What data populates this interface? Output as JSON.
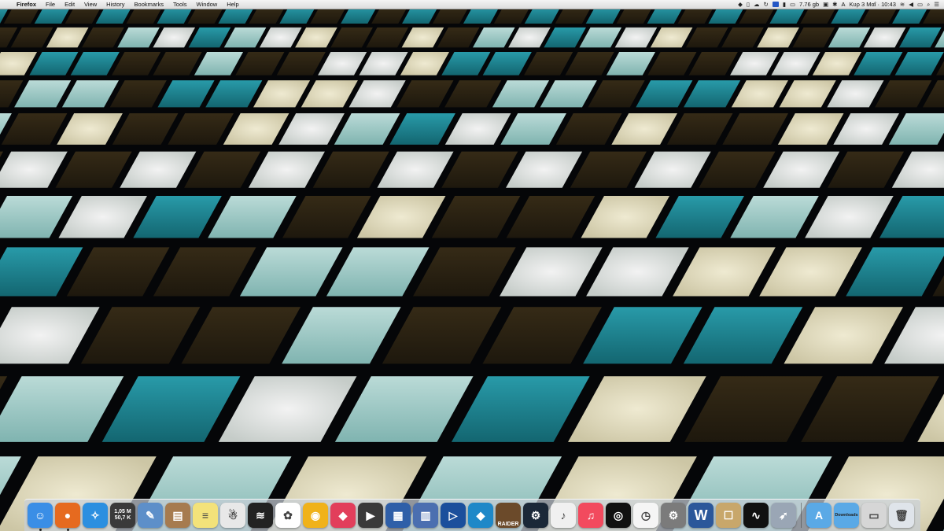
{
  "menubar": {
    "apple_glyph": "",
    "app_name": "Firefox",
    "menus": [
      "File",
      "Edit",
      "View",
      "History",
      "Bookmarks",
      "Tools",
      "Window",
      "Help"
    ],
    "status": {
      "disk_free": "7.76 gb",
      "keyboard": "A",
      "datetime": "Κυρ 3 Μαΐ · 10:43",
      "search_glyph": "⌕",
      "list_glyph": "☰"
    }
  },
  "dock": {
    "network_meter": {
      "upload": "1,05 M",
      "download": "50,7 K"
    },
    "tomb_raider_label": "RAIDER",
    "word_label": "W",
    "downloads_label": "Downloads",
    "apps": [
      {
        "name": "finder-icon",
        "color": "#3a8ee6",
        "glyph": "☺"
      },
      {
        "name": "firefox-icon",
        "color": "#e66a1f",
        "glyph": "●"
      },
      {
        "name": "safari-icon",
        "color": "#2b8fe0",
        "glyph": "✧"
      },
      {
        "name": "network-meter-icon",
        "color": "#3a3a3a",
        "glyph": ""
      },
      {
        "name": "preview-icon",
        "color": "#5d8fc9",
        "glyph": "✎"
      },
      {
        "name": "contacts-icon",
        "color": "#a67b4f",
        "glyph": "▤"
      },
      {
        "name": "notes-icon",
        "color": "#f3e27a",
        "glyph": "≡"
      },
      {
        "name": "ghost-app-icon",
        "color": "#e8e8e8",
        "glyph": "☃"
      },
      {
        "name": "wifi-scanner-icon",
        "color": "#222",
        "glyph": "≋"
      },
      {
        "name": "photos-icon",
        "color": "#ffffff",
        "glyph": "✿"
      },
      {
        "name": "color-picker-icon",
        "color": "#f0b21a",
        "glyph": "◉"
      },
      {
        "name": "color-wheel-icon",
        "color": "#e23e5b",
        "glyph": "◆"
      },
      {
        "name": "final-cut-icon",
        "color": "#3a3a3a",
        "glyph": "▶"
      },
      {
        "name": "screen-share-icon",
        "color": "#2f5fa8",
        "glyph": "▦"
      },
      {
        "name": "archive-utility-icon",
        "color": "#4b6fb0",
        "glyph": "▥"
      },
      {
        "name": "video-player-icon",
        "color": "#1b4f9c",
        "glyph": "▷"
      },
      {
        "name": "kodi-icon",
        "color": "#1e88c8",
        "glyph": "◆"
      },
      {
        "name": "tomb-raider-icon",
        "color": "#6b4a2a",
        "glyph": ""
      },
      {
        "name": "steam-icon",
        "color": "#1b2838",
        "glyph": "⚙"
      },
      {
        "name": "sheet-music-icon",
        "color": "#f0f0f0",
        "glyph": "♪"
      },
      {
        "name": "itunes-icon",
        "color": "#f24a5e",
        "glyph": "♫"
      },
      {
        "name": "vinyl-player-icon",
        "color": "#111",
        "glyph": "◎"
      },
      {
        "name": "clock-icon",
        "color": "#f5f5f5",
        "glyph": "◷"
      },
      {
        "name": "system-preferences-icon",
        "color": "#7b7b7b",
        "glyph": "⚙"
      },
      {
        "name": "word-icon",
        "color": "#2b579a",
        "glyph": ""
      },
      {
        "name": "installer-icon",
        "color": "#c8a76b",
        "glyph": "☐"
      },
      {
        "name": "activity-monitor-icon",
        "color": "#111",
        "glyph": "∿"
      },
      {
        "name": "launchpad-icon",
        "color": "#9aa6b5",
        "glyph": "➶"
      }
    ],
    "right_items": [
      {
        "name": "applications-folder-icon",
        "color": "#5aa9e6",
        "glyph": "A"
      },
      {
        "name": "downloads-folder-icon",
        "color": "#5aa9e6",
        "glyph": ""
      },
      {
        "name": "minimized-firefox-window-icon",
        "color": "#d6d6d6",
        "glyph": "▭"
      },
      {
        "name": "trash-icon",
        "color": "#dfe4ea",
        "glyph": "🗑"
      }
    ]
  },
  "colors": {
    "teal": "#1d8b98",
    "cream": "#e9e2c4",
    "white": "#f3f5ef",
    "brown": "#3b2e18",
    "pale_teal": "#9fd3d0"
  }
}
